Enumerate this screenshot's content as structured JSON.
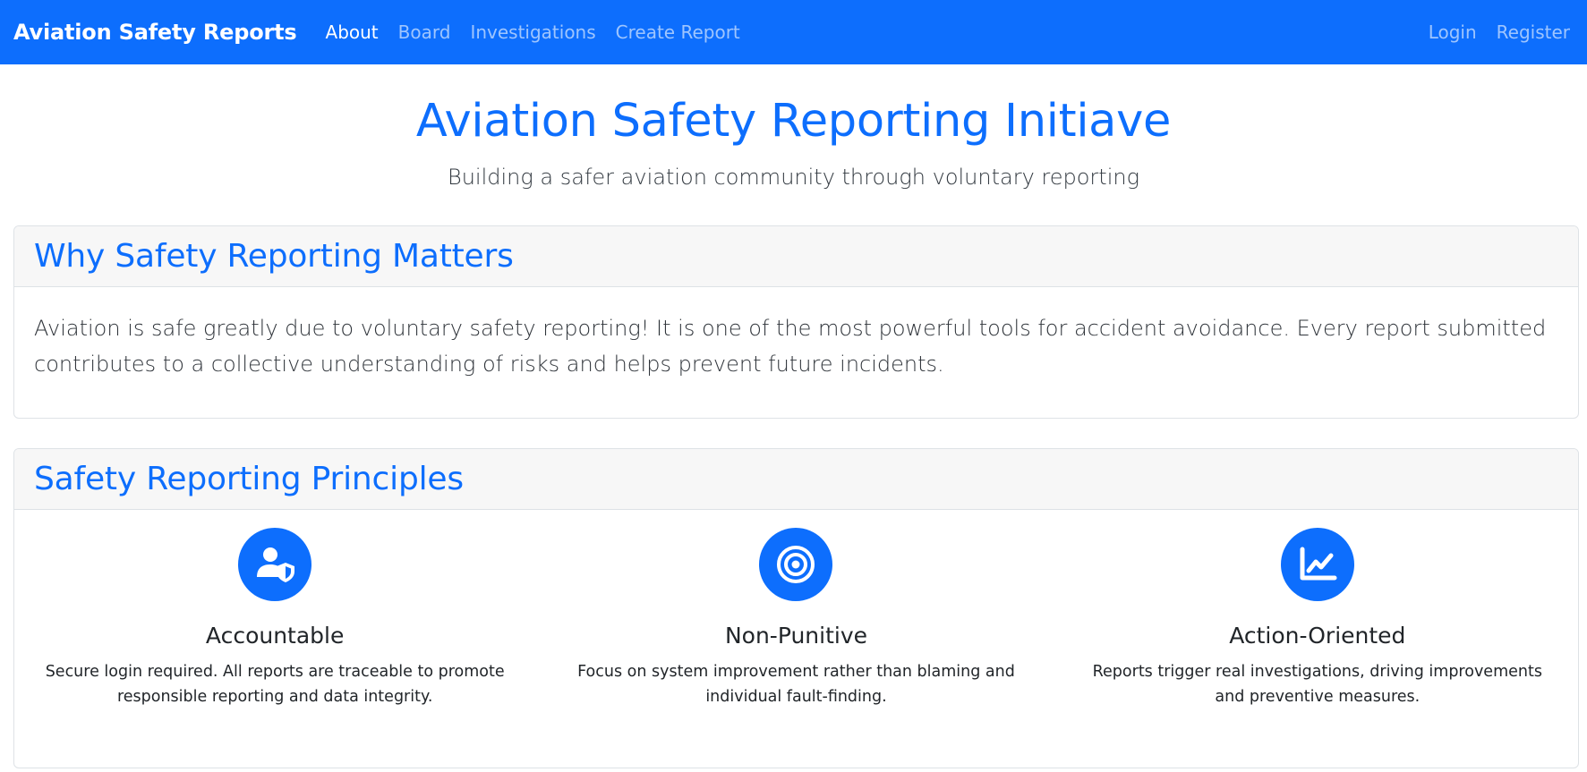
{
  "navbar": {
    "brand": "Aviation Safety Reports",
    "links": [
      "About",
      "Board",
      "Investigations",
      "Create Report"
    ],
    "right_links": [
      "Login",
      "Register"
    ],
    "active": "About",
    "color": "#0d6efd"
  },
  "hero": {
    "title": "Aviation Safety Reporting Initiave",
    "subtitle": "Building a safer aviation community through voluntary reporting"
  },
  "why_card": {
    "title": "Why Safety Reporting Matters",
    "body": "Aviation is safe greatly due to voluntary safety reporting! It is one of the most powerful tools for accident avoidance. Every report submitted contributes to a collective understanding of risks and helps prevent future incidents."
  },
  "principles_card": {
    "title": "Safety Reporting Principles",
    "items": [
      {
        "icon": "user-shield-icon",
        "title": "Accountable",
        "text": "Secure login required. All reports are traceable to promote responsible reporting and data integrity."
      },
      {
        "icon": "target-icon",
        "title": "Non-Punitive",
        "text": "Focus on system improvement rather than blaming and individual fault-finding."
      },
      {
        "icon": "chart-line-icon",
        "title": "Action-Oriented",
        "text": "Reports trigger real investigations, driving improvements and preventive measures."
      }
    ]
  }
}
